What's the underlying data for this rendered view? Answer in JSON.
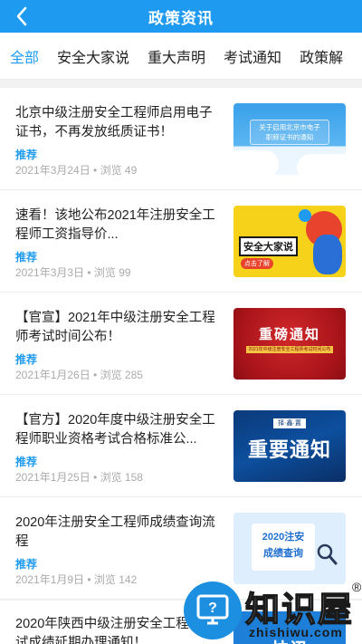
{
  "header": {
    "title": "政策资讯"
  },
  "tabs": [
    {
      "label": "全部",
      "active": true
    },
    {
      "label": "安全大家说",
      "active": false
    },
    {
      "label": "重大声明",
      "active": false
    },
    {
      "label": "考试通知",
      "active": false
    },
    {
      "label": "政策解",
      "active": false
    }
  ],
  "articles": [
    {
      "title": "北京中级注册安全工程师启用电子证书，不再发放纸质证书！",
      "tag": "推荐",
      "meta": "2021年3月24日 • 浏览 49",
      "thumb_text": [
        "关于启用北京市电子",
        "职称证书的通知"
      ]
    },
    {
      "title": "速看！该地公布2021年注册安全工程师工资指导价...",
      "tag": "推荐",
      "meta": "2021年3月3日 • 浏览 99",
      "thumb_text": [
        "安全大家说",
        "点击了解"
      ]
    },
    {
      "title": "【官宣】2021年中级注册安全工程师考试时间公布！",
      "tag": "推荐",
      "meta": "2021年1月26日 • 浏览 285",
      "thumb_text": [
        "重磅通知",
        "2021年中级注册安全工程师考试时间公布"
      ]
    },
    {
      "title": "【官方】2020年度中级注册安全工程师职业资格考试合格标准公...",
      "tag": "推荐",
      "meta": "2021年1月25日 • 浏览 158",
      "thumb_text": [
        "重要通知",
        "择·鑫·置"
      ]
    },
    {
      "title": "2020年注册安全工程师成绩查询流程",
      "tag": "推荐",
      "meta": "2021年1月9日 • 浏览 142",
      "thumb_text": [
        "2020注安",
        "成绩查询"
      ]
    },
    {
      "title": "2020年陕西中级注册安全工程师考试成绩延期办理通知！",
      "thumb_text": [
        "快讯"
      ]
    }
  ],
  "watermark": {
    "brand": "知识屋",
    "url": "zhishiwu.com",
    "reg": "®"
  },
  "colors": {
    "accent": "#1e9bf0",
    "topbar": "#1e9bf0"
  }
}
